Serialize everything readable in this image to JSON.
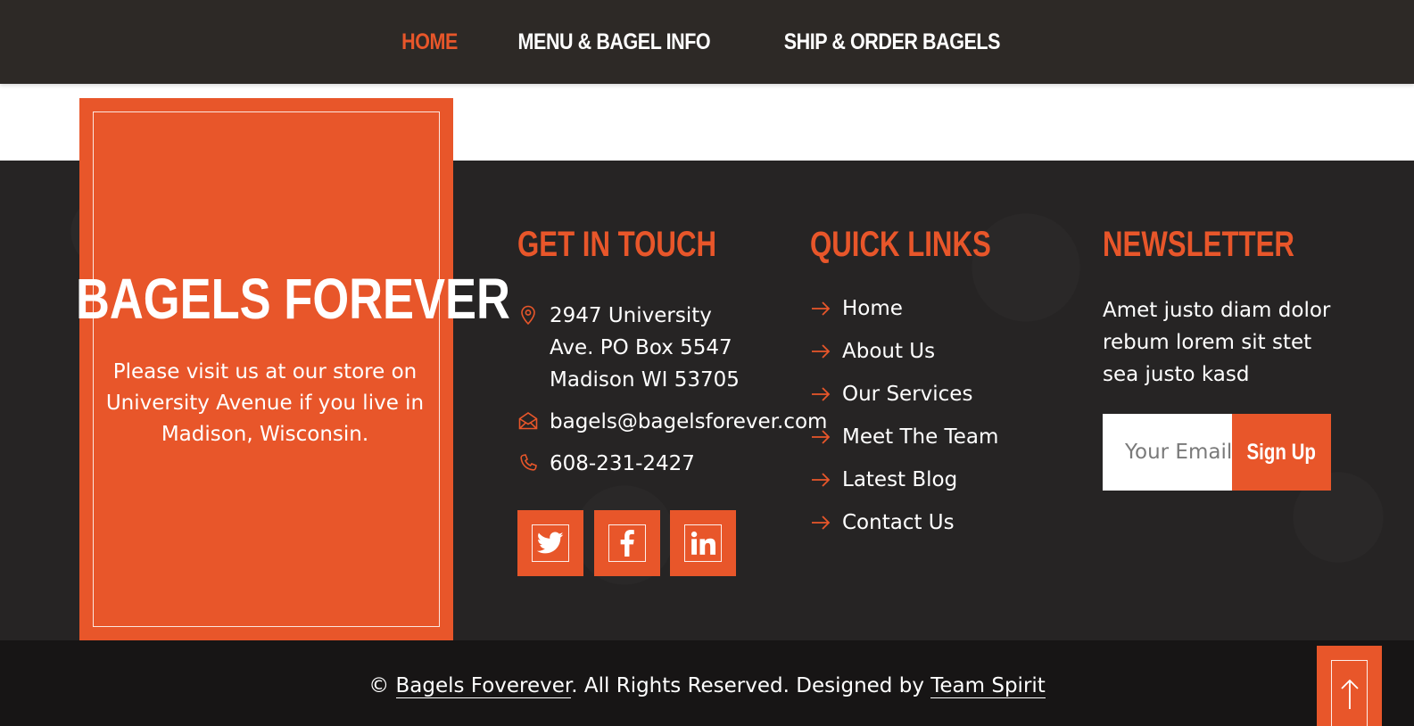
{
  "nav": {
    "items": [
      {
        "label": "HOME",
        "active": true
      },
      {
        "label": "MENU & BAGEL INFO",
        "active": false
      },
      {
        "label": "SHIP & ORDER BAGELS",
        "active": false
      }
    ]
  },
  "brand": {
    "title": "BAGELS FOREVER",
    "description": "Please visit us at our store on University Avenue if you live in Madison, Wisconsin."
  },
  "contact": {
    "heading": "GET IN TOUCH",
    "address_line1": "2947 University",
    "address_line2": "Ave. PO Box 5547",
    "address_line3": "Madison WI 53705",
    "email": "bagels@bagelsforever.com",
    "phone": "608-231-2427",
    "social": [
      "twitter-icon",
      "facebook-icon",
      "linkedin-icon"
    ]
  },
  "quick_links": {
    "heading": "QUICK LINKS",
    "items": [
      "Home",
      "About Us",
      "Our Services",
      "Meet The Team",
      "Latest Blog",
      "Contact Us"
    ]
  },
  "newsletter": {
    "heading": "NEWSLETTER",
    "description": "Amet justo diam dolor rebum lorem sit stet sea justo kasd",
    "email_placeholder": "Your Email",
    "button_label": "Sign Up"
  },
  "footer": {
    "copyright_symbol": "©",
    "site_link": "Bagels Foverever",
    "rights_text": ". All Rights Reserved. Designed by ",
    "designer_link": "Team Spirit"
  },
  "colors": {
    "accent": "#e8562a",
    "nav_bg": "#2d2926",
    "footer_bg": "#262424",
    "bottom_bg": "#171515"
  }
}
